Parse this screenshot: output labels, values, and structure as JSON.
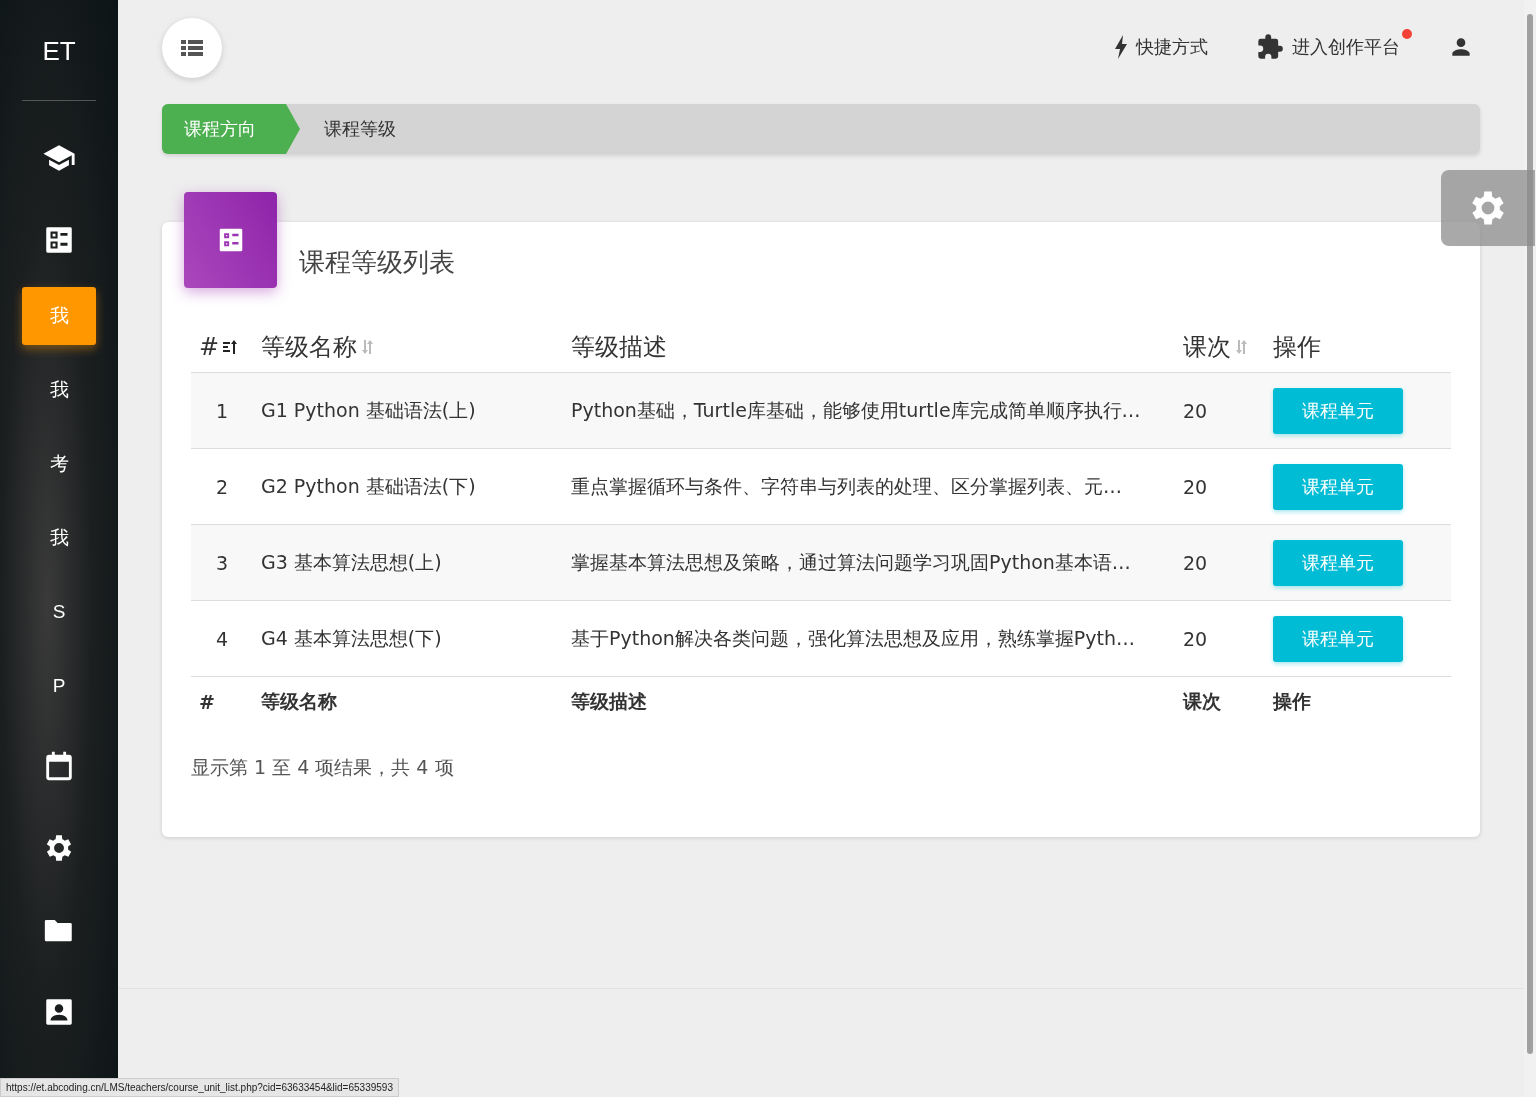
{
  "sidebar": {
    "logo": "ET",
    "items": [
      {
        "label": "我",
        "selected": true
      },
      {
        "label": "我",
        "selected": false
      },
      {
        "label": "考",
        "selected": false
      },
      {
        "label": "我",
        "selected": false
      },
      {
        "label": "S",
        "selected": false
      },
      {
        "label": "P",
        "selected": false
      }
    ]
  },
  "topbar": {
    "shortcuts": "快捷方式",
    "creator_platform": "进入创作平台",
    "creator_notification": true
  },
  "breadcrumb": [
    {
      "label": "课程方向",
      "selected": true
    },
    {
      "label": "课程等级",
      "selected": false
    }
  ],
  "card": {
    "title": "课程等级列表",
    "columns": [
      {
        "label": "#",
        "sortable": true,
        "sorted": true
      },
      {
        "label": "等级名称",
        "sortable": true,
        "sorted": false
      },
      {
        "label": "等级描述",
        "sortable": false,
        "sorted": false
      },
      {
        "label": "课次",
        "sortable": true,
        "sorted": false
      },
      {
        "label": "操作",
        "sortable": false,
        "sorted": false
      }
    ],
    "rows": [
      {
        "index": "1",
        "name": "G1 Python 基础语法(上)",
        "description": "Python基础，Turtle库基础，能够使用turtle库完成简单顺序执行…",
        "lessons": "20",
        "action": "课程单元"
      },
      {
        "index": "2",
        "name": "G2 Python 基础语法(下)",
        "description": "重点掌握循环与条件、字符串与列表的处理、区分掌握列表、元…",
        "lessons": "20",
        "action": "课程单元"
      },
      {
        "index": "3",
        "name": "G3 基本算法思想(上)",
        "description": "掌握基本算法思想及策略，通过算法问题学习巩固Python基本语…",
        "lessons": "20",
        "action": "课程单元"
      },
      {
        "index": "4",
        "name": "G4 基本算法思想(下)",
        "description": "基于Python解决各类问题，强化算法思想及应用，熟练掌握Pyth…",
        "lessons": "20",
        "action": "课程单元"
      }
    ],
    "footer": [
      "#",
      "等级名称",
      "等级描述",
      "课次",
      "操作"
    ],
    "info": "显示第 1 至 4 项结果，共 4 项"
  },
  "status_bar": {
    "url": "https://et.abcoding.cn/LMS/teachers/course_unit_list.php?cid=63633454&lid=65339593"
  }
}
